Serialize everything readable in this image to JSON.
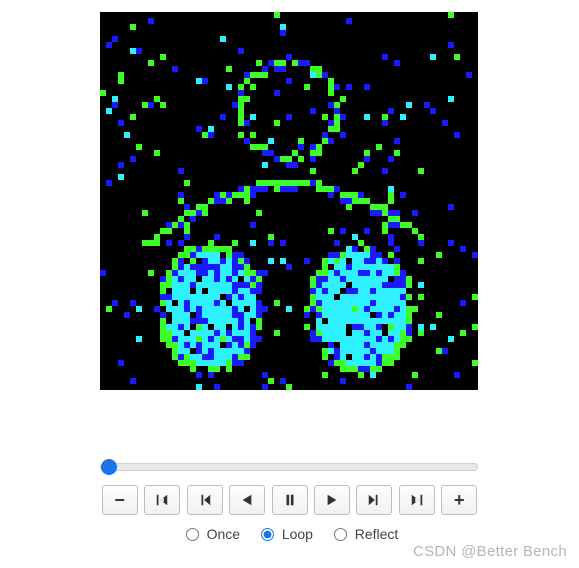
{
  "frame": {
    "background": "#000000",
    "palette_green": "#3cff2a",
    "palette_cyan": "#2ef0ff",
    "palette_blue": "#1a1aff",
    "description": "Pixelated upper-body figure (appears to be a boxing silhouette) rendered in green/blue/cyan point-cloud on black background with scattered noise"
  },
  "slider": {
    "value": 0,
    "min": 0,
    "max": 100
  },
  "controls": {
    "slower_label": "−",
    "first_title": "First frame",
    "prev_title": "Previous frame",
    "reverse_title": "Play reverse",
    "pause_title": "Pause",
    "play_title": "Play",
    "next_title": "Next frame",
    "last_title": "Last frame",
    "faster_label": "+"
  },
  "loop": {
    "once": "Once",
    "loop": "Loop",
    "reflect": "Reflect",
    "selected": "loop"
  },
  "watermark": "CSDN @Better Bench"
}
